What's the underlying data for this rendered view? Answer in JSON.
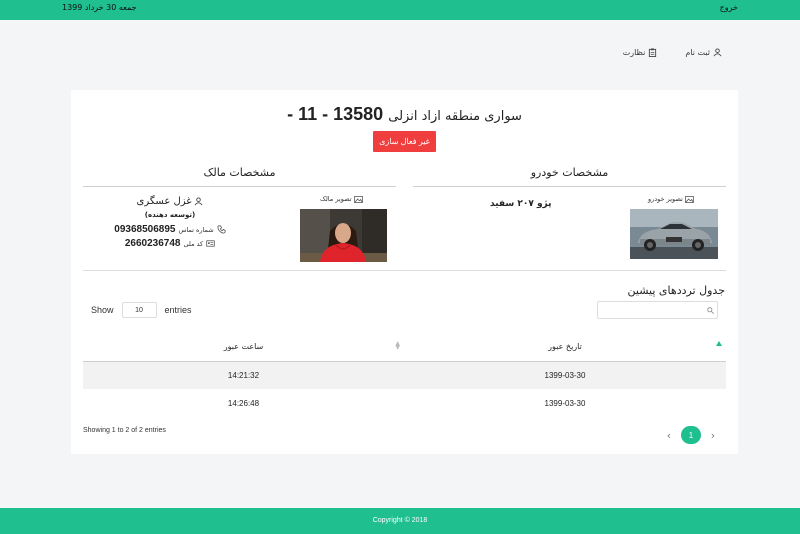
{
  "topbar": {
    "date": "جمعه 30 خرداد 1399",
    "logout": "خروج"
  },
  "nav": {
    "supervision": "نظارت",
    "register": "ثبت نام"
  },
  "vehicle": {
    "name": "سواری منطقه ازاد انزلی",
    "plate": "13580 - 11 -",
    "deactivate": "غیر فعال سازی"
  },
  "vehicle_section": {
    "title": "مشخصات خودرو",
    "image_label": "تصویر خودرو",
    "model": "پژو ۲۰۷ سفید"
  },
  "owner_section": {
    "title": "مشخصات مالک",
    "image_label": "تصویر مالک",
    "name": "غزل عسگری",
    "role": "(توسعه دهنده)",
    "phone_label": "شماره تماس",
    "phone": "09368506895",
    "id_label": "کد ملی",
    "national_id": "2660236748"
  },
  "history": {
    "title": "جدول ترددهای پیشین",
    "show_label": "Show",
    "page_size": "10",
    "entries_label": "entries",
    "columns": [
      "تاریخ عبور",
      "ساعت عبور"
    ],
    "rows": [
      {
        "date": "1399-03-30",
        "time": "14:21:32"
      },
      {
        "date": "1399-03-30",
        "time": "14:26:48"
      }
    ],
    "info": "Showing 1 to 2 of 2 entries",
    "current_page": "1",
    "prev": "‹",
    "next": "›"
  },
  "footer": {
    "copyright": "Copyright © 2018"
  },
  "colors": {
    "accent": "#1fbf8f",
    "danger": "#f03e3e"
  }
}
